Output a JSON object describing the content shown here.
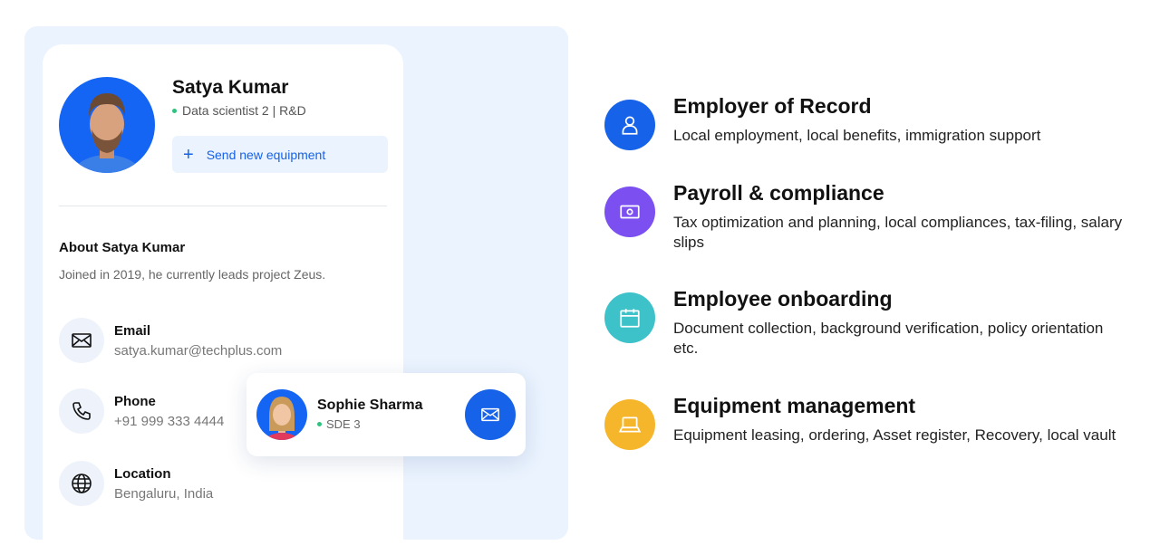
{
  "profile": {
    "name": "Satya Kumar",
    "role": "Data scientist 2 |  R&D",
    "send_button": "Send new equipment",
    "about_title": "About Satya Kumar",
    "about_text": "Joined in 2019, he currently leads project Zeus.",
    "contacts": [
      {
        "label": "Email",
        "value": "satya.kumar@techplus.com",
        "icon": "mail-icon"
      },
      {
        "label": "Phone",
        "value": "+91 999 333 4444",
        "icon": "phone-icon"
      },
      {
        "label": "Location",
        "value": "Bengaluru, India",
        "icon": "globe-icon"
      }
    ]
  },
  "contact_card": {
    "name": "Sophie Sharma",
    "role": "SDE 3",
    "action_icon": "mail-icon"
  },
  "features": [
    {
      "title": "Employer of Record",
      "desc": "Local employment, local benefits, immigration support",
      "icon": "person-icon",
      "color": "#1662e8"
    },
    {
      "title": "Payroll & compliance",
      "desc": "Tax optimization and planning, local compliances, tax-filing, salary slips",
      "icon": "cash-icon",
      "color": "#7b4ff0"
    },
    {
      "title": "Employee onboarding",
      "desc": "Document collection, background verification, policy orientation etc.",
      "icon": "calendar-icon",
      "color": "#3cc2c8"
    },
    {
      "title": "Equipment management",
      "desc": "Equipment leasing, ordering, Asset register, Recovery, local vault",
      "icon": "laptop-icon",
      "color": "#f6b62b"
    }
  ],
  "colors": {
    "accent": "#1662e8",
    "panel_bg": "#eaf3fe",
    "status_green": "#2ec27e"
  }
}
